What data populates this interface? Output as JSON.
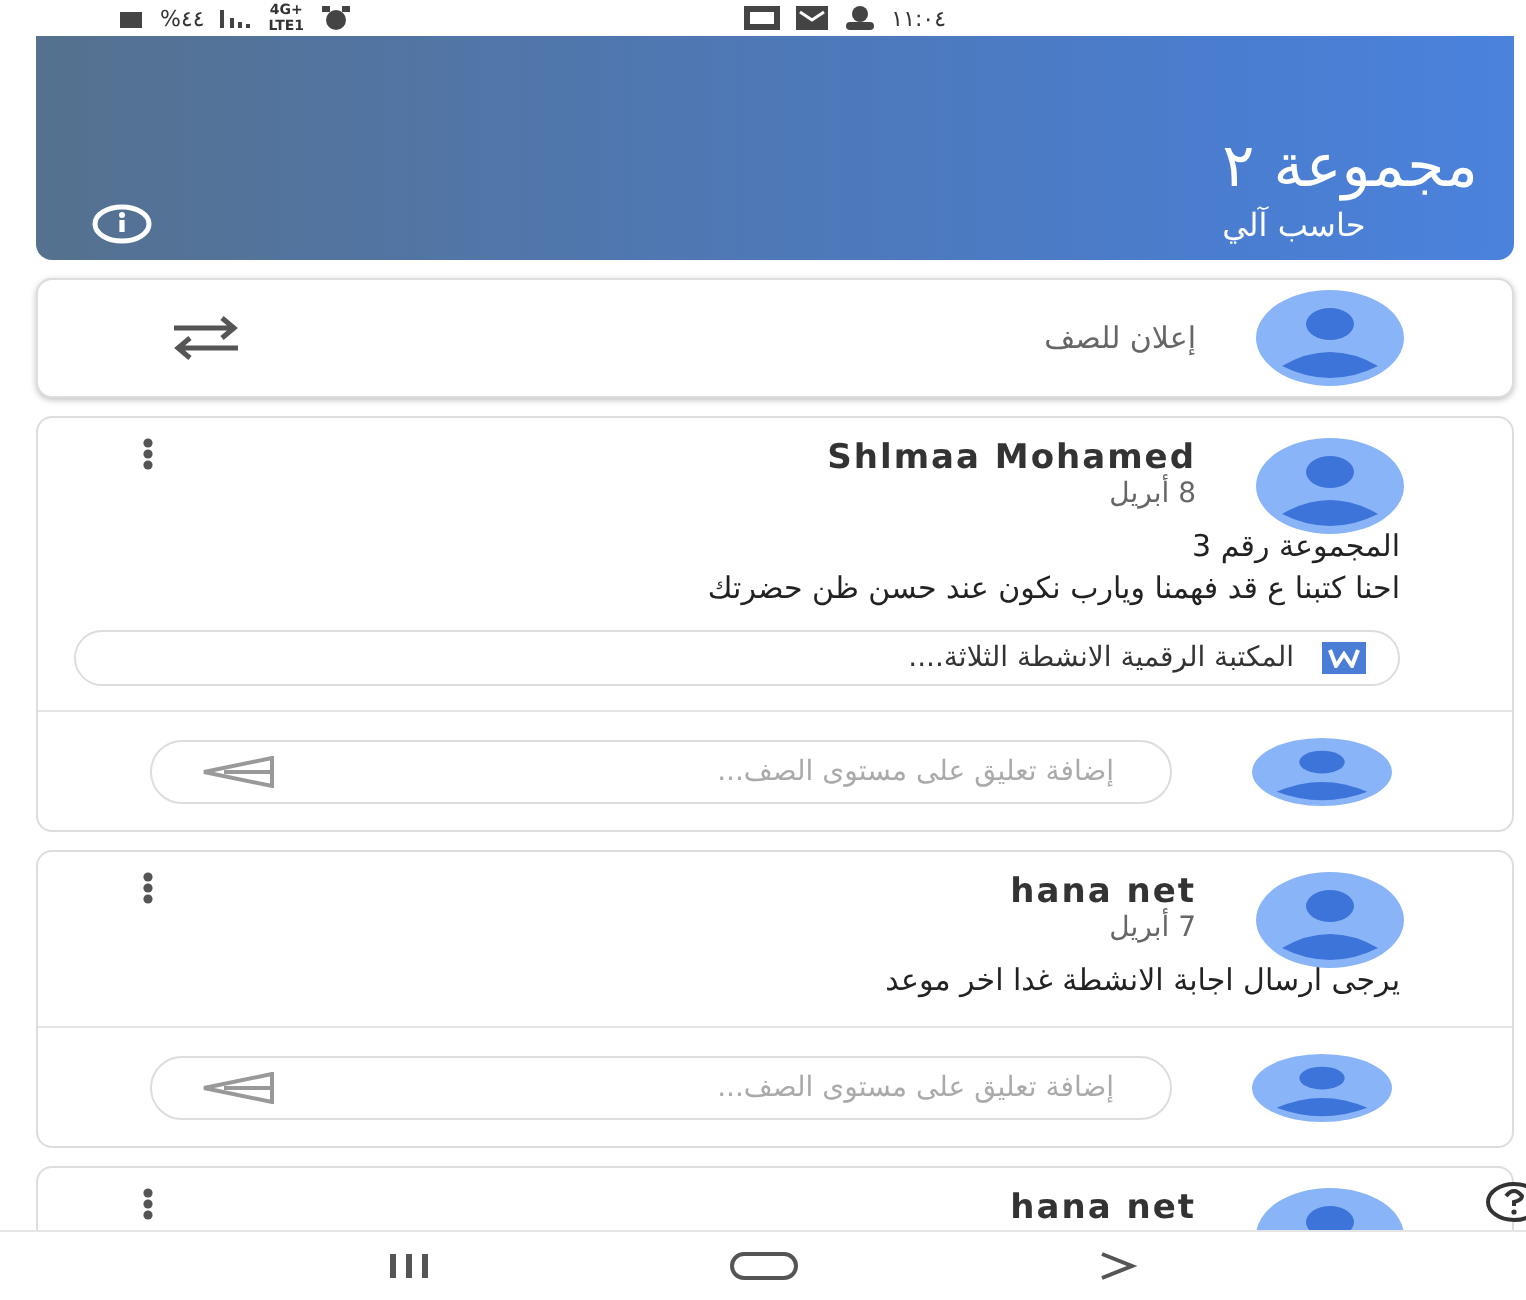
{
  "status_bar": {
    "time": "١١:٠٤",
    "battery": "%٤٤",
    "network": [
      "4G+",
      "LTE1"
    ]
  },
  "header": {
    "title": "مجموعة ٢",
    "subtitle": "حاسب آلي"
  },
  "announce": {
    "placeholder": "إعلان للصف"
  },
  "posts": [
    {
      "author": "Shlmaa Mohamed",
      "date": "8 أبريل",
      "body": [
        "المجموعة رقم 3",
        "احنا كتبنا ع قد فهمنا ويارب نكون عند حسن ظن حضرتك"
      ],
      "attachment": {
        "title": "المكتبة الرقمية الانشطة الثلاثة...."
      },
      "comment_placeholder": "إضافة تعليق على مستوى الصف..."
    },
    {
      "author": "hana net",
      "date": "7 أبريل",
      "body": [
        "يرجى ارسال اجابة الانشطة غدا اخر موعد"
      ],
      "comment_placeholder": "إضافة تعليق على مستوى الصف..."
    },
    {
      "author": "hana net"
    }
  ]
}
